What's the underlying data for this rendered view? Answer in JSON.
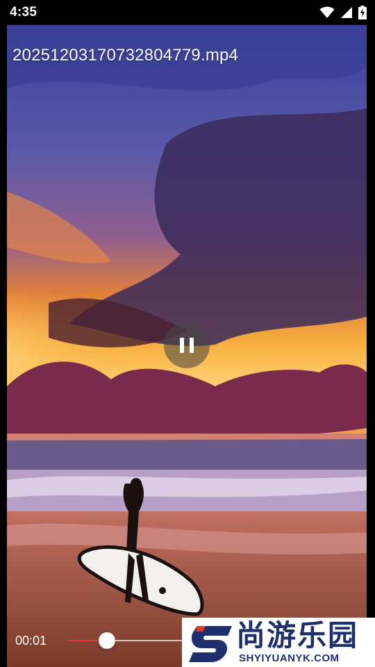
{
  "status_bar": {
    "time": "4:35"
  },
  "player": {
    "file_name": "20251203170732804779.mp4",
    "current_time": "00:01",
    "progress": 0.33
  },
  "watermark": {
    "chinese": "尚游乐园",
    "english": "SHYIYUANYK.COM"
  },
  "colors": {
    "seek_progress": "#e53935",
    "watermark_text": "#1e2f6e"
  }
}
